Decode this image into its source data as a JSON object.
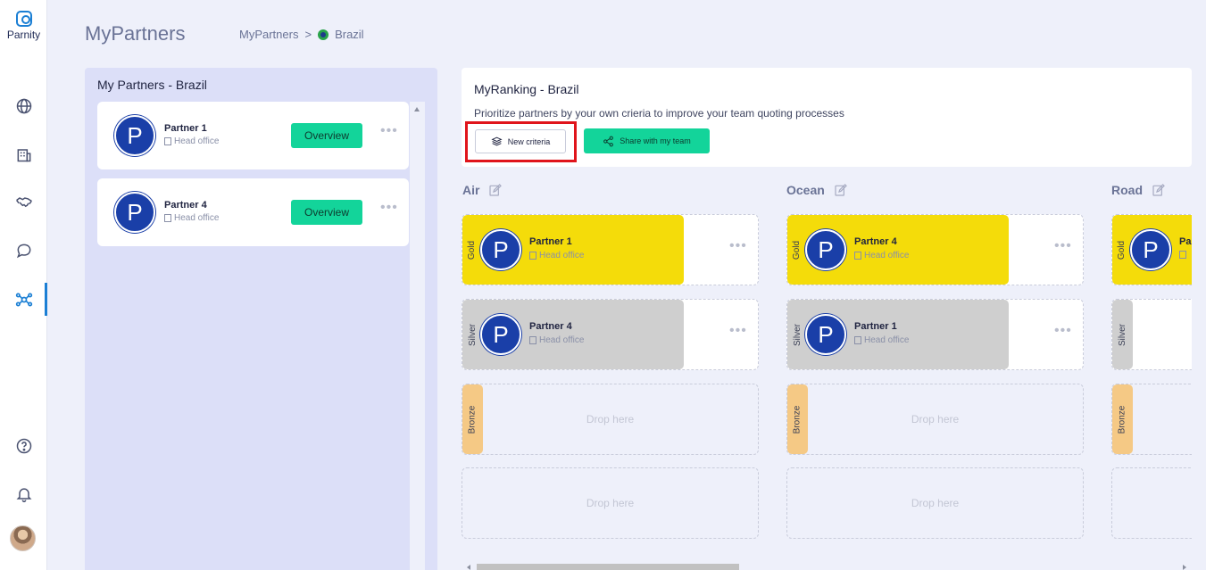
{
  "app": {
    "logo_text": "Parnity",
    "title": "MyPartners"
  },
  "breadcrumb": {
    "root": "MyPartners",
    "separator": ">",
    "current": "Brazil"
  },
  "rail": {
    "icons": [
      "globe-icon",
      "building-icon",
      "handshake-icon",
      "chat-icon",
      "network-icon",
      "help-icon",
      "bell-icon"
    ],
    "active": "network-icon"
  },
  "partners_panel": {
    "title": "My Partners - Brazil",
    "cards": [
      {
        "initial": "P",
        "name": "Partner 1",
        "location": "Head office",
        "action": "Overview"
      },
      {
        "initial": "P",
        "name": "Partner 4",
        "location": "Head office",
        "action": "Overview"
      }
    ]
  },
  "ranking": {
    "title": "MyRanking - Brazil",
    "description": "Prioritize partners by your own crieria to improve your team quoting processes",
    "new_criteria_label": "New criteria",
    "share_label": "Share with my team"
  },
  "columns": [
    {
      "title": "Air",
      "slots": [
        {
          "tier": "Gold",
          "partner": {
            "initial": "P",
            "name": "Partner 1",
            "location": "Head office"
          }
        },
        {
          "tier": "Silver",
          "partner": {
            "initial": "P",
            "name": "Partner 4",
            "location": "Head office"
          }
        },
        {
          "tier": "Bronze",
          "drop_text": "Drop here"
        },
        {
          "tier": "",
          "drop_text": "Drop here"
        }
      ]
    },
    {
      "title": "Ocean",
      "slots": [
        {
          "tier": "Gold",
          "partner": {
            "initial": "P",
            "name": "Partner 4",
            "location": "Head office"
          }
        },
        {
          "tier": "Silver",
          "partner": {
            "initial": "P",
            "name": "Partner 1",
            "location": "Head office"
          }
        },
        {
          "tier": "Bronze",
          "drop_text": "Drop here"
        },
        {
          "tier": "",
          "drop_text": "Drop here"
        }
      ]
    },
    {
      "title": "Road",
      "slots": [
        {
          "tier": "Gold",
          "partner": {
            "initial": "P",
            "name": "Pa"
          }
        },
        {
          "tier": "Silver"
        },
        {
          "tier": "Bronze"
        },
        {
          "tier": ""
        }
      ]
    }
  ],
  "colors": {
    "accent": "#13d49a",
    "brand": "#1a3fa8",
    "gold": "#f4dc0a",
    "silver": "#cfcfcf",
    "bronze": "#f5c985",
    "highlight": "#e0141b"
  }
}
